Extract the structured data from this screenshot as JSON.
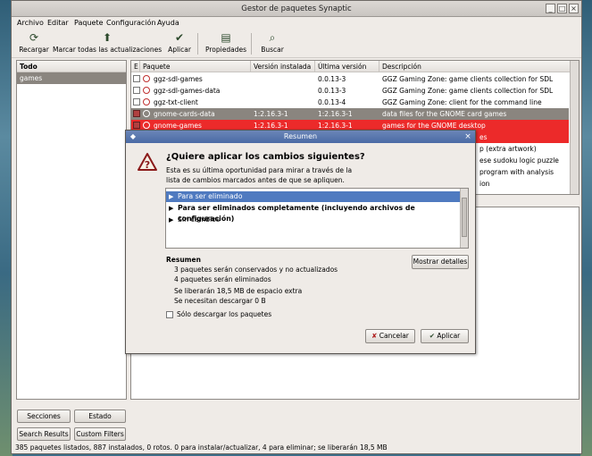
{
  "window": {
    "title": "Gestor de paquetes Synaptic"
  },
  "menu": [
    "Archivo",
    "Editar",
    "Paquete",
    "Configuración",
    "Ayuda"
  ],
  "toolbar": {
    "reload": "Recargar",
    "mark_all": "Marcar todas las actualizaciones",
    "apply": "Aplicar",
    "properties": "Propiedades",
    "search": "Buscar"
  },
  "sidebar": {
    "header": "Todo",
    "selected": "games",
    "buttons": [
      "Secciones",
      "Estado",
      "Search Results",
      "Custom Filters"
    ]
  },
  "package_list": {
    "columns": [
      "E",
      "Paquete",
      "Versión instalada",
      "Última versión",
      "Descripción"
    ],
    "rows": [
      {
        "name": "ggz-sdl-games",
        "installed": "",
        "latest": "0.0.13-3",
        "description": "GGZ Gaming Zone: game clients collection for SDL",
        "state": "normal"
      },
      {
        "name": "ggz-sdl-games-data",
        "installed": "",
        "latest": "0.0.13-3",
        "description": "GGZ Gaming Zone: game clients collection for SDL",
        "state": "normal"
      },
      {
        "name": "ggz-txt-client",
        "installed": "",
        "latest": "0.0.13-4",
        "description": "GGZ Gaming Zone: client for the command line",
        "state": "normal"
      },
      {
        "name": "gnome-cards-data",
        "installed": "1:2.16.3-1",
        "latest": "1:2.16.3-1",
        "description": "data files for the GNOME card games",
        "state": "gray"
      },
      {
        "name": "gnome-games",
        "installed": "1:2.16.3-1",
        "latest": "1:2.16.3-1",
        "description": "games for the GNOME desktop",
        "state": "red"
      }
    ],
    "partial_descriptions": [
      "es",
      "p (extra artwork)",
      "ese sudoku logic puzzle",
      "program with analysis",
      "ion"
    ]
  },
  "status_bar": "385 paquetes listados, 887 instalados, 0 rotos. 0 para instalar/actualizar, 4 para eliminar; se liberarán 18,5 MB",
  "dialog": {
    "title": "Resumen",
    "heading": "¿Quiere aplicar los cambios siguientes?",
    "description": "Esta es su última oportunidad para mirar a través de la lista de cambios marcados antes de que se apliquen.",
    "changes": [
      "Para ser eliminado",
      "Para ser eliminados completamente (incluyendo archivos de configuración)",
      "Sin cambios"
    ],
    "summary_heading": "Resumen",
    "summary_lines": [
      "3 paquetes serán conservados y no actualizados",
      "4 paquetes serán eliminados",
      "Se liberarán 18,5 MB de espacio extra",
      "Se necesitan descargar 0  B"
    ],
    "show_details": "Mostrar detalles",
    "download_only": "Sólo descargar los paquetes",
    "cancel": "Cancelar",
    "apply": "Aplicar"
  }
}
